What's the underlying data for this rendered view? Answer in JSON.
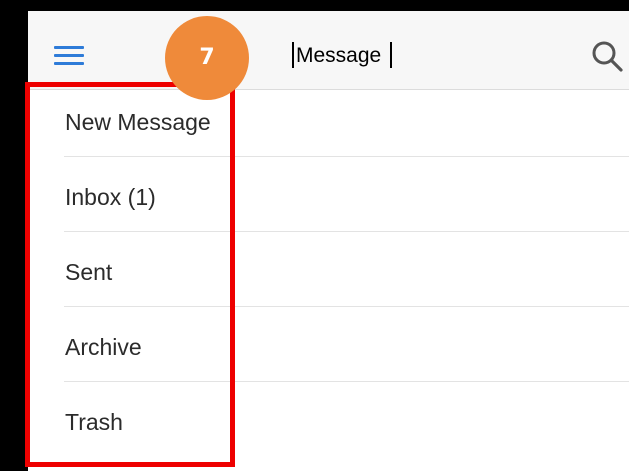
{
  "header": {
    "search_value": "Message",
    "menu_icon": "hamburger-icon",
    "search_icon": "search-icon",
    "accent_color": "#2e7bd8"
  },
  "badge": {
    "number": "7",
    "color": "#ef8a3a"
  },
  "highlight_color": "#ee0000",
  "sidebar": {
    "items": [
      {
        "label": "New Message"
      },
      {
        "label": "Inbox (1)"
      },
      {
        "label": "Sent"
      },
      {
        "label": "Archive"
      },
      {
        "label": "Trash"
      }
    ]
  }
}
